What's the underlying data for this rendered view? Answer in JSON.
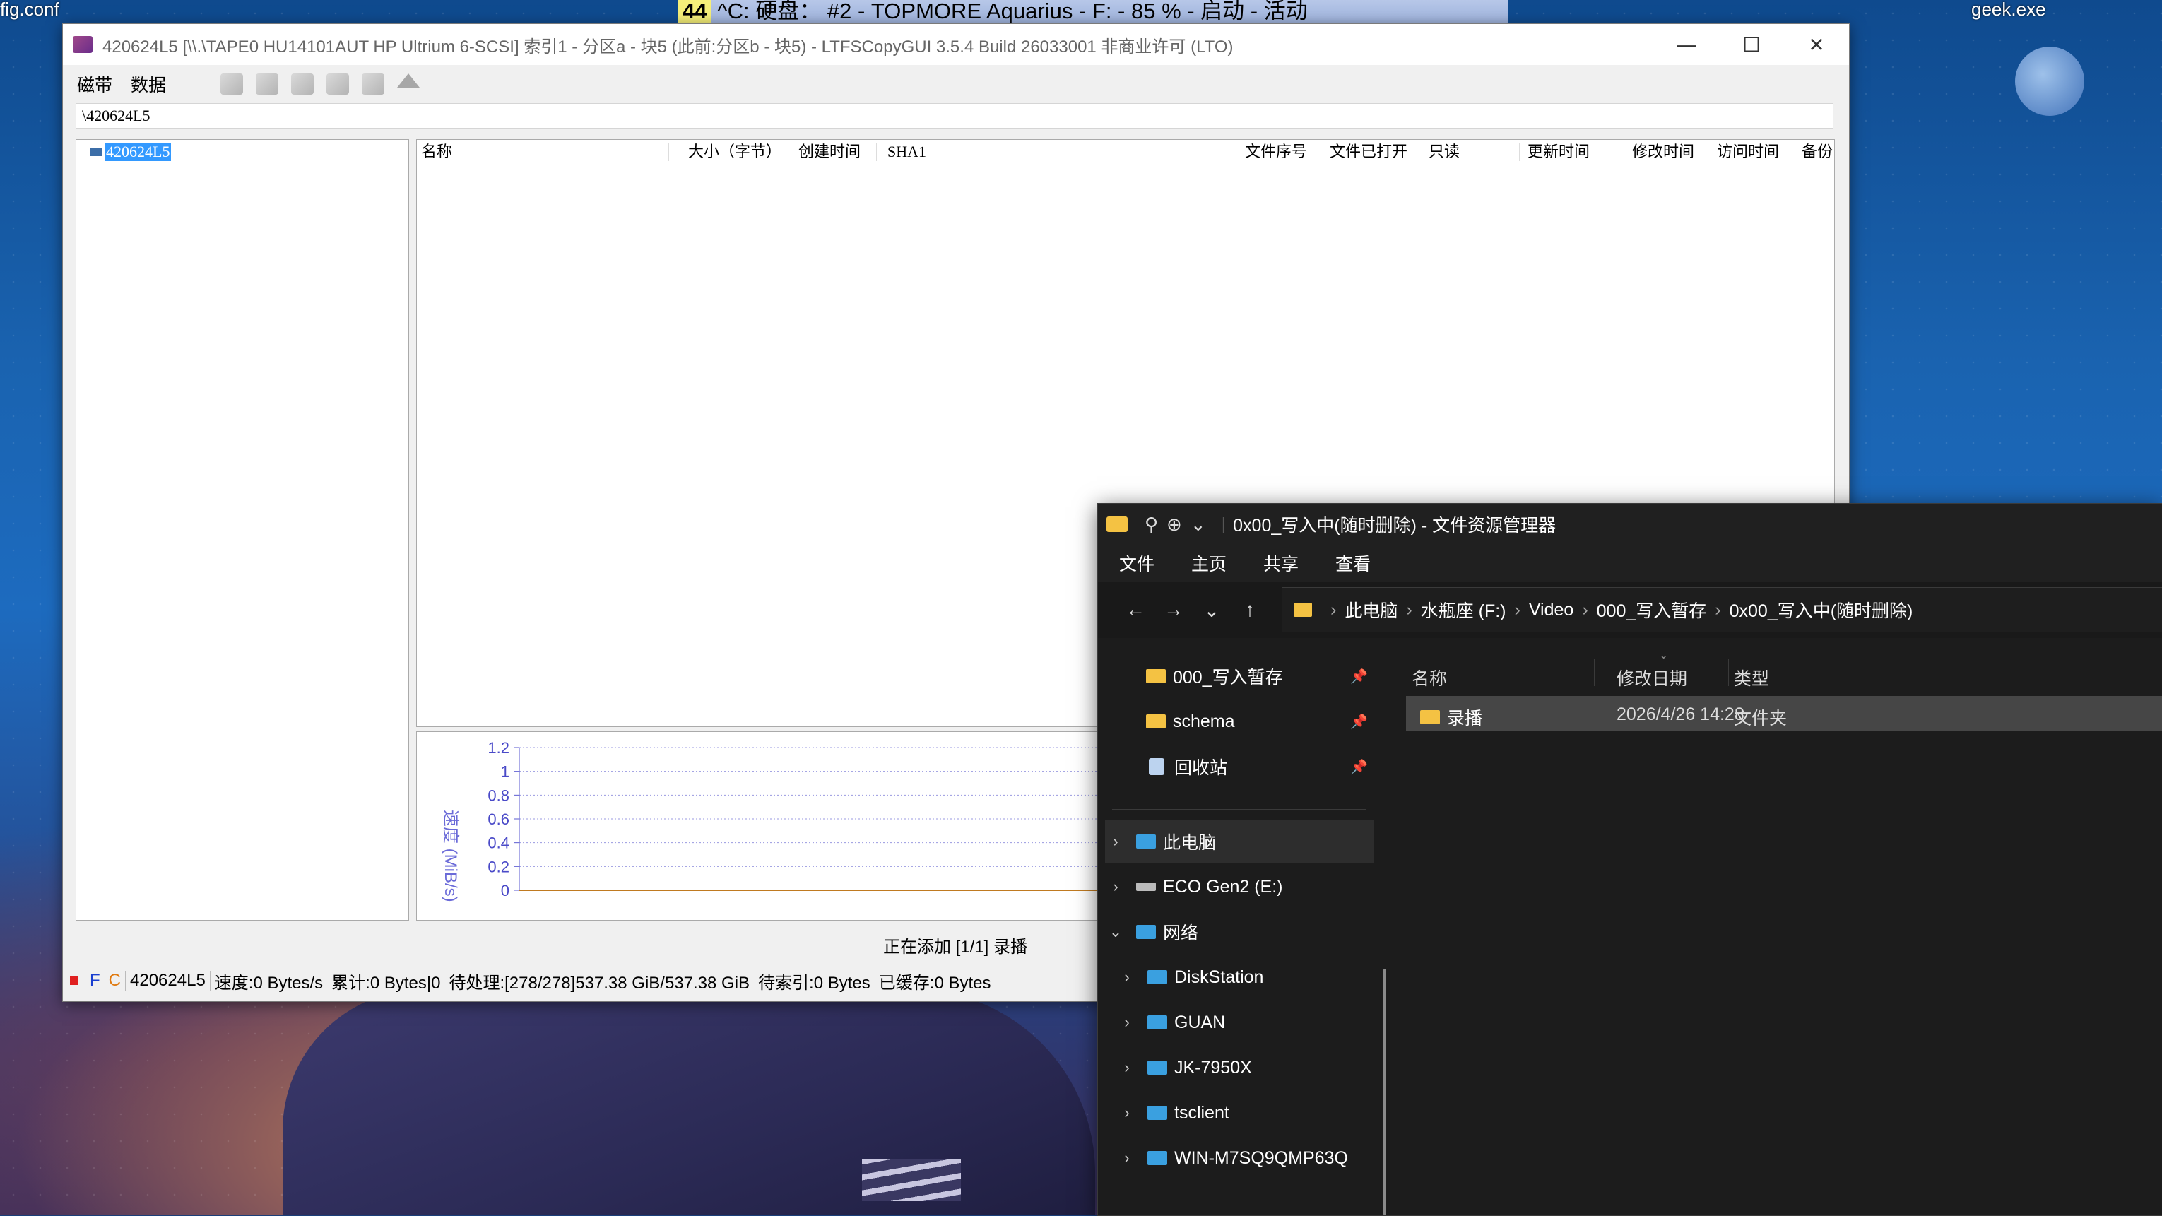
{
  "desktop": {
    "left_text": "fig.conf",
    "right_text": "geek.exe",
    "status_pill": {
      "num": "44",
      "text": "^C: 硬盘：  #2 - TOPMORE Aquarius - F: - 85 % - 启动 - 活动"
    }
  },
  "ltfs": {
    "title": "420624L5 [\\\\.\\TAPE0 HU14101AUT HP Ultrium 6-SCSI] 索引1 - 分区a - 块5 (此前:分区b - 块5) - LTFSCopyGUI 3.5.4 Build 26033001 非商业许可 (LTO)",
    "menu": [
      "磁带",
      "数据"
    ],
    "path": "\\420624L5",
    "tree_root": "420624L5",
    "columns": [
      "名称",
      "大小（字节）",
      "创建时间",
      "SHA1",
      "文件序号",
      "文件已打开",
      "只读",
      "更新时间",
      "修改时间",
      "访问时间",
      "备份"
    ],
    "chart": {
      "ylabel": "速度 (MiB/s)"
    },
    "status_middle": "正在添加 [1/1] 录播",
    "statusbar": {
      "f": "F",
      "c": "C",
      "tape": "420624L5",
      "speed": "速度:0 Bytes/s",
      "total": "累计:0 Bytes|0",
      "pending": "待处理:[278/278]537.38 GiB/537.38 GiB",
      "indexing": "待索引:0 Bytes",
      "cached": "已缓存:0 Bytes"
    }
  },
  "chart_data": {
    "type": "line",
    "title": "",
    "xlabel": "",
    "ylabel": "速度 (MiB/s)",
    "ylim": [
      0,
      1.2
    ],
    "yticks": [
      "1.2",
      "1",
      "0.8",
      "0.6",
      "0.4",
      "0.2",
      "0"
    ],
    "series": [
      {
        "values": [
          0,
          0,
          0,
          0,
          0,
          0,
          0,
          0,
          0,
          0
        ]
      }
    ],
    "grid": true
  },
  "explorer": {
    "title": "0x00_写入中(随时删除) - 文件资源管理器",
    "tabs": [
      "文件",
      "主页",
      "共享",
      "查看"
    ],
    "breadcrumb": [
      "此电脑",
      "水瓶座 (F:)",
      "Video",
      "000_写入暂存",
      "0x00_写入中(随时删除)"
    ],
    "quick": [
      {
        "label": "000_写入暂存",
        "icon": "folder-icon"
      },
      {
        "label": "schema",
        "icon": "folder-icon"
      },
      {
        "label": "回收站",
        "icon": "recycle-bin-icon"
      }
    ],
    "tree": {
      "this_pc": "此电脑",
      "eco": "ECO Gen2 (E:)",
      "network": "网络",
      "hosts": [
        "DiskStation",
        "GUAN",
        "JK-7950X",
        "tsclient",
        "WIN-M7SQ9QMP63Q"
      ]
    },
    "columns": {
      "name": "名称",
      "modified": "修改日期",
      "type": "类型"
    },
    "files": [
      {
        "name": "录播",
        "modified": "2026/4/26 14:28",
        "type": "文件夹"
      }
    ]
  },
  "colors": {
    "folder": "#f4c243",
    "selection": "#3399ff",
    "accent": "#0063b1"
  }
}
